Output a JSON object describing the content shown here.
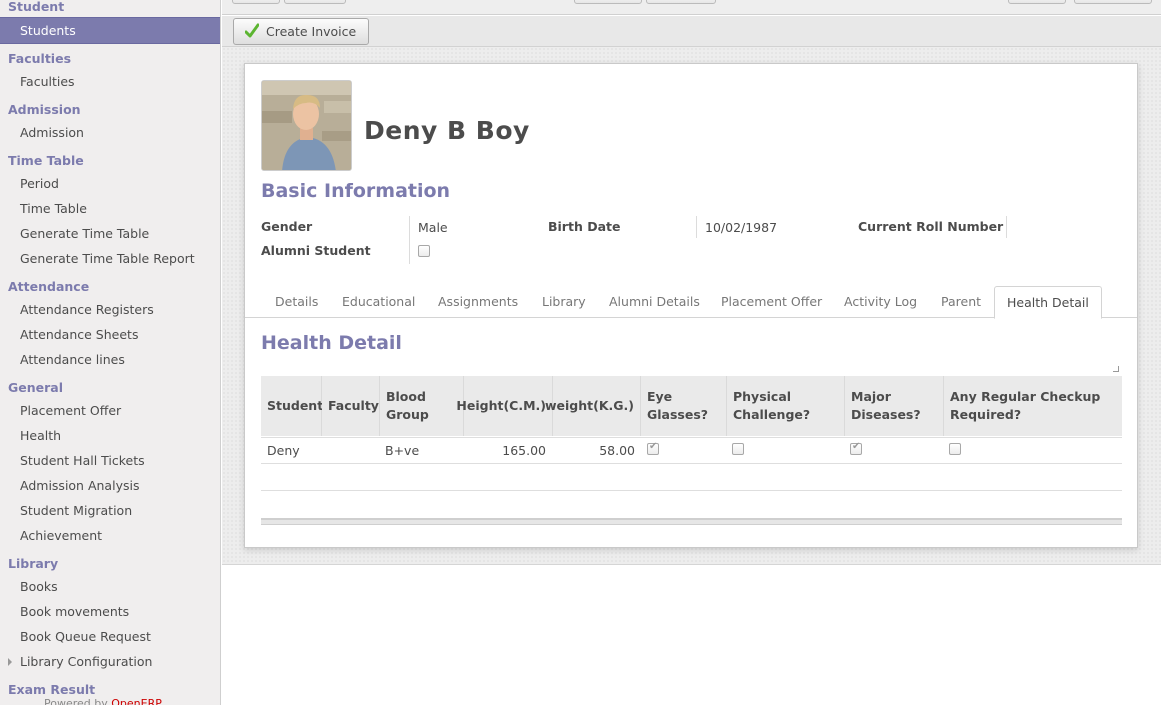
{
  "sidebar": {
    "sections": [
      {
        "title": "Student",
        "items": [
          "Students"
        ]
      },
      {
        "title": "Faculties",
        "items": [
          "Faculties"
        ]
      },
      {
        "title": "Admission",
        "items": [
          "Admission"
        ]
      },
      {
        "title": "Time Table",
        "items": [
          "Period",
          "Time Table",
          "Generate Time Table",
          "Generate Time Table Report"
        ]
      },
      {
        "title": "Attendance",
        "items": [
          "Attendance Registers",
          "Attendance Sheets",
          "Attendance lines"
        ]
      },
      {
        "title": "General",
        "items": [
          "Placement Offer",
          "Health",
          "Student Hall Tickets",
          "Admission Analysis",
          "Student Migration",
          "Achievement"
        ]
      },
      {
        "title": "Library",
        "items": [
          "Books",
          "Book movements",
          "Book Queue Request",
          "Library Configuration"
        ]
      },
      {
        "title": "Exam Result",
        "items": []
      }
    ],
    "active_item": "Students",
    "footer": {
      "prefix": "Powered by ",
      "brand": "OpenERP"
    }
  },
  "toolbar": {
    "create_invoice_label": "Create Invoice"
  },
  "student": {
    "name": "Deny B Boy",
    "basic_info_title": "Basic Information",
    "gender_label": "Gender",
    "gender_value": "Male",
    "birth_date_label": "Birth Date",
    "birth_date_value": "10/02/1987",
    "roll_label": "Current Roll Number",
    "roll_value": "",
    "alumni_label": "Alumni Student",
    "alumni_value": false
  },
  "tabs": [
    "Details",
    "Educational",
    "Assignments",
    "Library",
    "Alumni Details",
    "Placement Offer",
    "Activity Log",
    "Parent",
    "Health Detail"
  ],
  "active_tab": "Health Detail",
  "health": {
    "title": "Health Detail",
    "columns": [
      "Student",
      "Faculty",
      "Blood Group",
      "Height(C.M.)",
      "weight(K.G.)",
      "Eye Glasses?",
      "Physical Challenge?",
      "Major Diseases?",
      "Any Regular Checkup Required?"
    ],
    "rows": [
      {
        "student": "Deny",
        "faculty": "",
        "blood_group": "B+ve",
        "height": "165.00",
        "weight": "58.00",
        "eye_glasses": true,
        "physical_challenge": false,
        "major_diseases": true,
        "regular_checkup": false
      }
    ]
  },
  "colors": {
    "accent": "#7c7bad",
    "sidebar_bg": "#f0eeee",
    "text": "#4c4c4c"
  }
}
